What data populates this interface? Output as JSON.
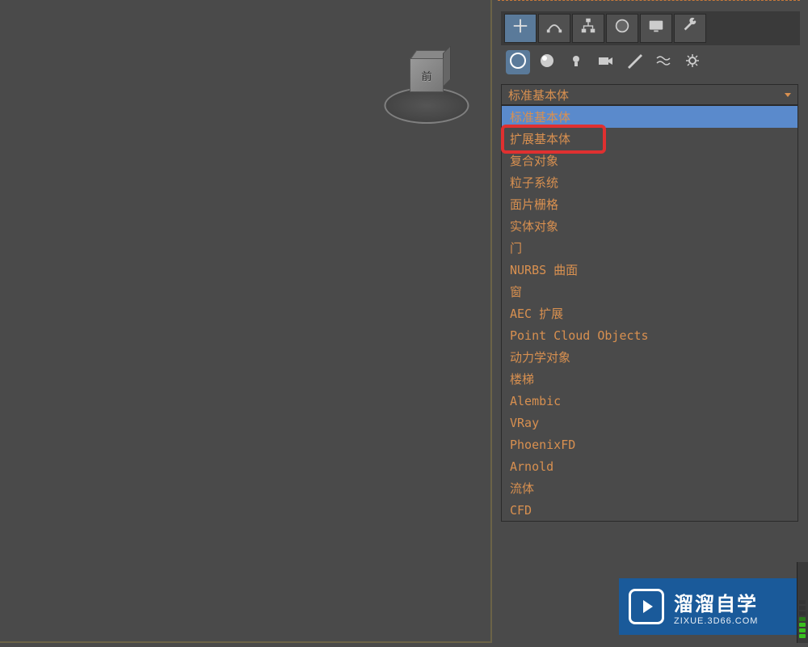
{
  "viewcube": {
    "face_label": "前"
  },
  "toolbar": {
    "tabs": [
      {
        "name": "create",
        "icon": "plus"
      },
      {
        "name": "modify",
        "icon": "arc"
      },
      {
        "name": "hierarchy",
        "icon": "pivot"
      },
      {
        "name": "motion",
        "icon": "sphere"
      },
      {
        "name": "display",
        "icon": "monitor"
      },
      {
        "name": "utilities",
        "icon": "wrench"
      }
    ]
  },
  "subtabs": [
    {
      "name": "geometry",
      "icon": "sphere-outline",
      "active": true
    },
    {
      "name": "shapes",
      "icon": "sphere-shaded"
    },
    {
      "name": "lights",
      "icon": "light"
    },
    {
      "name": "cameras",
      "icon": "camera"
    },
    {
      "name": "helpers",
      "icon": "ruler"
    },
    {
      "name": "spacewarps",
      "icon": "waves"
    },
    {
      "name": "systems",
      "icon": "gear"
    }
  ],
  "dropdown": {
    "current": "标准基本体",
    "items": [
      {
        "label": "标准基本体",
        "highlighted": true
      },
      {
        "label": "扩展基本体"
      },
      {
        "label": "复合对象"
      },
      {
        "label": "粒子系统"
      },
      {
        "label": "面片栅格"
      },
      {
        "label": "实体对象"
      },
      {
        "label": "门"
      },
      {
        "label": "NURBS 曲面"
      },
      {
        "label": "窗"
      },
      {
        "label": "AEC 扩展"
      },
      {
        "label": "Point Cloud Objects"
      },
      {
        "label": "动力学对象"
      },
      {
        "label": "楼梯"
      },
      {
        "label": "Alembic"
      },
      {
        "label": "VRay"
      },
      {
        "label": "PhoenixFD"
      },
      {
        "label": "Arnold"
      },
      {
        "label": "流体"
      },
      {
        "label": "CFD"
      }
    ]
  },
  "watermark": {
    "title": "溜溜自学",
    "subtitle": "ZIXUE.3D66.COM"
  }
}
